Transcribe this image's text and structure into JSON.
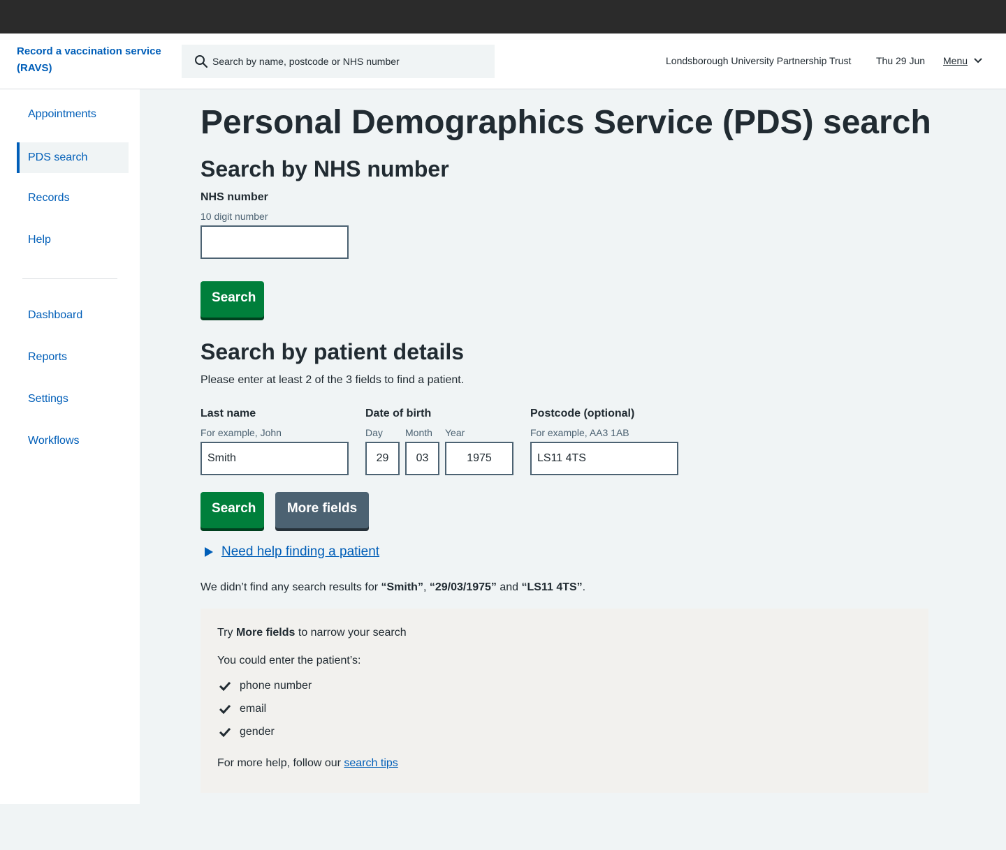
{
  "header": {
    "brand": "Record a vaccination service (RAVS)",
    "search_placeholder": "Search by name, postcode or NHS number",
    "organisation": "Londsborough University Partnership Trust",
    "date": "Thu 29 Jun",
    "menu_label": "Menu"
  },
  "sidebar": {
    "primary": [
      {
        "label": "Appointments",
        "active": false
      },
      {
        "label": "PDS search",
        "active": true
      },
      {
        "label": "Records",
        "active": false
      },
      {
        "label": "Help",
        "active": false
      }
    ],
    "secondary": [
      {
        "label": "Dashboard"
      },
      {
        "label": "Reports"
      },
      {
        "label": "Settings"
      },
      {
        "label": "Workflows"
      }
    ]
  },
  "main": {
    "title": "Personal Demographics Service (PDS) search",
    "nhs_section": {
      "heading": "Search by NHS number",
      "label": "NHS number",
      "hint": "10 digit number",
      "value": "",
      "button": "Search"
    },
    "details_section": {
      "heading": "Search by patient details",
      "instruction": "Please enter at least 2 of the 3 fields to find a patient.",
      "last_name": {
        "label": "Last name",
        "hint": "For example, John",
        "value": "Smith"
      },
      "dob": {
        "label": "Date of birth",
        "day_label": "Day",
        "day_value": "29",
        "month_label": "Month",
        "month_value": "03",
        "year_label": "Year",
        "year_value": "1975"
      },
      "postcode": {
        "label": "Postcode (optional)",
        "hint": "For example, AA3 1AB",
        "value": "LS11 4TS"
      },
      "search_button": "Search",
      "more_fields_button": "More fields",
      "help_link": "Need help finding a patient"
    },
    "result": {
      "prefix": "We didn’t find any search results for ",
      "term1": "“Smith”",
      "sep1": ", ",
      "term2": "“29/03/1975”",
      "sep2": " and ",
      "term3": "“LS11 4TS”",
      "suffix": "."
    },
    "panel": {
      "try_prefix": "Try ",
      "try_bold": "More fields",
      "try_suffix": " to narrow your search",
      "could_enter": "You could enter the patient’s:",
      "items": [
        "phone number",
        "email",
        "gender"
      ],
      "help_prefix": "For more help, follow our ",
      "help_link": "search tips"
    }
  }
}
